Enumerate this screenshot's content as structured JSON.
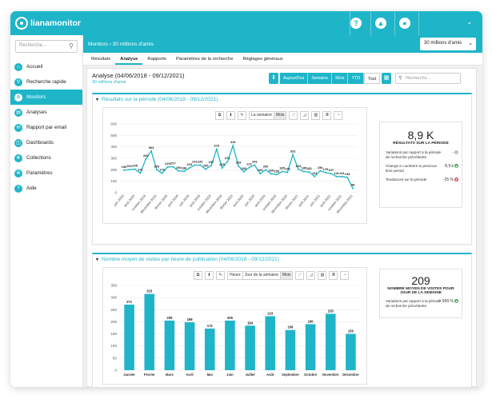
{
  "app": {
    "name": "lianamonitor",
    "brand_color": "#1fb5c8",
    "top_icons": [
      "help-icon",
      "bell-icon",
      "user-icon"
    ]
  },
  "sidebar": {
    "search_placeholder": "Recherche...",
    "items": [
      {
        "label": "Accueil",
        "icon": "home-icon"
      },
      {
        "label": "Recherche rapide",
        "icon": "search-icon"
      },
      {
        "label": "Monitors",
        "icon": "crosshair-icon",
        "active": true
      },
      {
        "label": "Analyses",
        "icon": "chart-icon"
      },
      {
        "label": "Rapport par email",
        "icon": "mail-icon"
      },
      {
        "label": "Dashboards",
        "icon": "dashboard-icon"
      },
      {
        "label": "Collections",
        "icon": "collection-icon"
      },
      {
        "label": "Paramètres",
        "icon": "gear-icon"
      },
      {
        "label": "Aide",
        "icon": "help-icon"
      }
    ]
  },
  "breadcrumb": {
    "root": "Monitors",
    "separator": "›",
    "current": "30 millions d'amis",
    "selector": "30 millions d'amis"
  },
  "tabs": [
    {
      "label": "Résultats"
    },
    {
      "label": "Analyse",
      "active": true
    },
    {
      "label": "Rapports"
    },
    {
      "label": "Paramètres de la recherche"
    },
    {
      "label": "Réglages généraux"
    }
  ],
  "analysis": {
    "title": "Analyse (04/06/2018 - 09/12/2021)",
    "subtitle": "30 millions d'amis",
    "periods": [
      "Aujourd'hui",
      "Semaine",
      "Mois",
      "YTD",
      "Tout"
    ],
    "selected_period": "Tout",
    "search_placeholder": "Recherche..."
  },
  "section1": {
    "title": "Résultats sur la période (04/06/2018 - 09/12/2021)",
    "toolbar": [
      "La semaine",
      "Mois"
    ],
    "selected": "Mois",
    "stat": {
      "big": "8,9 K",
      "caption": "RÉSULTATS SUR LA PÉRIODE",
      "rows": [
        {
          "label": "Variations par rapport à la période de recherche précédente",
          "value": "-",
          "status": "neutral"
        },
        {
          "label": "Change in numbers to previous time period",
          "value": "8,9 k",
          "status": "up"
        },
        {
          "label": "Tendances sur la période",
          "value": "-25 %",
          "status": "down"
        }
      ]
    }
  },
  "section2": {
    "title": "Nombre moyen de visites par heure de publication (04/06/2018 - 09/12/2021)",
    "toolbar": [
      "Heure",
      "Jour de la semaine",
      "Mois"
    ],
    "selected": "Mois",
    "stat": {
      "big": "209",
      "caption": "NOMBRE MOYEN DE VISITES POUR JOUR DE LA SEMAINE",
      "rows": [
        {
          "label": "Variations par rapport à la période de recherche précédente",
          "value": "> 999 %",
          "status": "up"
        }
      ]
    }
  },
  "chart_data": [
    {
      "type": "line",
      "ylim": [
        0,
        600
      ],
      "yticks": [
        0,
        100,
        200,
        300,
        400,
        500,
        600
      ],
      "x": [
        "juin 2018",
        "juillet 2018",
        "août 2018",
        "septembre 2018",
        "octobre 2018",
        "novembre 2018",
        "décembre 2018",
        "janvier 2019",
        "février 2019",
        "mars 2019",
        "avril 2019",
        "mai 2019",
        "juin 2019",
        "juillet 2019",
        "août 2019",
        "septembre 2019",
        "octobre 2019",
        "novembre 2019",
        "décembre 2019",
        "janvier 2020",
        "février 2020",
        "mars 2020",
        "avril 2020",
        "mai 2020",
        "juin 2020",
        "juillet 2020",
        "août 2020",
        "septembre 2020",
        "octobre 2020",
        "novembre 2020",
        "décembre 2020",
        "janvier 2021",
        "février 2021",
        "mars 2021",
        "avril 2021",
        "mai 2021",
        "juin 2021",
        "juillet 2021",
        "août 2021",
        "septembre 2021",
        "octobre 2021",
        "novembre 2021",
        "décembre 2021"
      ],
      "values": [
        196,
        201,
        205,
        171,
        292,
        364,
        200,
        170,
        225,
        227,
        190,
        186,
        215,
        241,
        241,
        205,
        237,
        379,
        215,
        271,
        410,
        233,
        183,
        221,
        241,
        166,
        200,
        165,
        158,
        185,
        178,
        332,
        204,
        185,
        181,
        141,
        190,
        176,
        167,
        141,
        141,
        134,
        38
      ],
      "labels": [
        "196",
        "201",
        "205",
        "171",
        "292",
        "364",
        "200",
        "170",
        "225",
        "227",
        "190",
        "186",
        "215",
        "241",
        "241",
        "205",
        "237",
        "379",
        "215",
        "271",
        "410",
        "233",
        "183",
        "221",
        "241",
        "166",
        "200",
        "165",
        "158",
        "185",
        "178",
        "332",
        "204",
        "185",
        "181",
        "141",
        "190",
        "176",
        "167",
        "141",
        "141",
        "134",
        "38"
      ],
      "xtick_labels": [
        "juin 2018",
        "août 2018",
        "octobre 2018",
        "décembre 2018",
        "février 2019",
        "avril 2019",
        "juin 2019",
        "août 2019",
        "octobre 2019",
        "décembre 2019",
        "février 2020",
        "avril 2020",
        "juin 2020",
        "août 2020",
        "octobre 2020",
        "décembre 2020",
        "février 2021",
        "avril 2021",
        "juin 2021",
        "août 2021",
        "octobre 2021",
        "décembre 2021"
      ],
      "color": "#1fb5c8"
    },
    {
      "type": "bar",
      "ylim": [
        0,
        350
      ],
      "yticks": [
        0,
        50,
        100,
        150,
        200,
        250,
        300,
        350
      ],
      "categories": [
        "Janvier",
        "Février",
        "Mars",
        "Avril",
        "Mai",
        "Juin",
        "Juillet",
        "Août",
        "Septembre",
        "Octobre",
        "Novembre",
        "Décembre"
      ],
      "values": [
        271,
        315,
        205,
        198,
        172,
        205,
        184,
        223,
        166,
        190,
        233,
        150
      ],
      "color": "#1fb5c8"
    }
  ]
}
